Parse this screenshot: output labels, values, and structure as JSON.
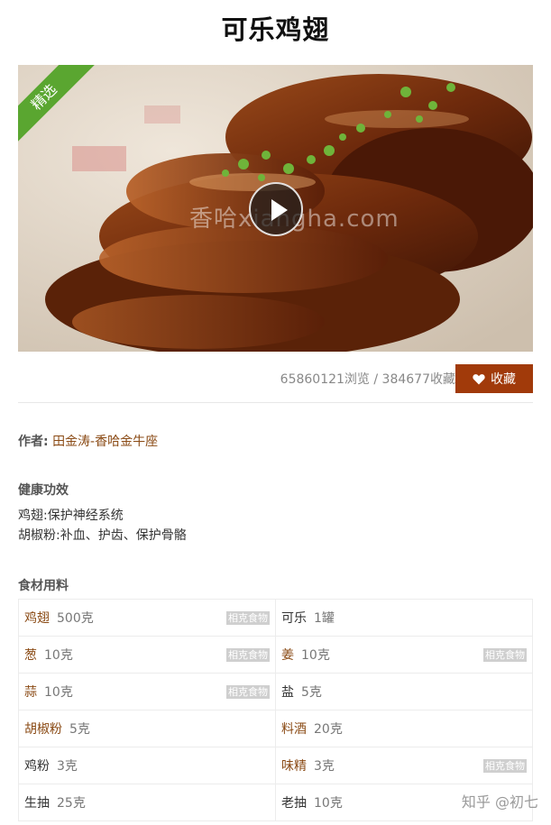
{
  "title": "可乐鸡翅",
  "hero": {
    "badge": "精选",
    "watermark": "香哈xiangha.com",
    "play_icon": "play-icon"
  },
  "stats": {
    "text": "65860121浏览 / 384677收藏",
    "favorite_label": "收藏",
    "favorite_icon": "heart-icon"
  },
  "author": {
    "label": "作者:",
    "name": "田金涛-香哈金牛座"
  },
  "health": {
    "title": "健康功效",
    "lines": [
      "鸡翅:保护神经系统",
      "胡椒粉:补血、护齿、保护骨骼"
    ]
  },
  "ingredients": {
    "title": "食材用料",
    "tag_label": "相克食物",
    "rows": [
      [
        {
          "name": "鸡翅",
          "amount": "500克",
          "link": true,
          "tag": true
        },
        {
          "name": "可乐",
          "amount": "1罐",
          "link": false,
          "tag": false
        }
      ],
      [
        {
          "name": "葱",
          "amount": "10克",
          "link": true,
          "tag": true
        },
        {
          "name": "姜",
          "amount": "10克",
          "link": true,
          "tag": true
        }
      ],
      [
        {
          "name": "蒜",
          "amount": "10克",
          "link": true,
          "tag": true
        },
        {
          "name": "盐",
          "amount": "5克",
          "link": false,
          "tag": false
        }
      ],
      [
        {
          "name": "胡椒粉",
          "amount": "5克",
          "link": true,
          "tag": false
        },
        {
          "name": "料酒",
          "amount": "20克",
          "link": true,
          "tag": false
        }
      ],
      [
        {
          "name": "鸡粉",
          "amount": "3克",
          "link": false,
          "tag": false
        },
        {
          "name": "味精",
          "amount": "3克",
          "link": true,
          "tag": true
        }
      ],
      [
        {
          "name": "生抽",
          "amount": "25克",
          "link": false,
          "tag": false
        },
        {
          "name": "老抽",
          "amount": "10克",
          "link": false,
          "tag": false
        }
      ]
    ]
  },
  "footer_watermark": "知乎 @初七",
  "colors": {
    "brand_button": "#a13a0a",
    "badge_green": "#5aa630",
    "link_brown": "#8a4a14"
  }
}
